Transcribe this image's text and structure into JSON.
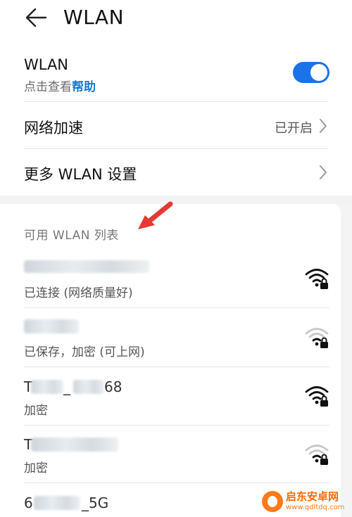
{
  "header": {
    "title": "WLAN"
  },
  "wlan_toggle": {
    "label": "WLAN",
    "sub_prefix": "点击查看",
    "sub_link": "帮助",
    "enabled": true,
    "accent": "#1a73e8"
  },
  "speedup": {
    "label": "网络加速",
    "value": "已开启"
  },
  "more": {
    "label": "更多 WLAN 设置"
  },
  "section": {
    "title": "可用 WLAN 列表"
  },
  "networks": [
    {
      "ssid": "",
      "status": "已连接 (网络质量好)",
      "signal_icon": "wifi-locked-strong-icon"
    },
    {
      "ssid": "",
      "status": "已保存，加密 (可上网)",
      "signal_icon": "wifi-locked-weak-icon"
    },
    {
      "ssid": "T_68",
      "ssid_visible": "68",
      "ssid_prefix": "T",
      "ssid_mid": "_",
      "status": "加密",
      "signal_icon": "wifi-locked-strong-icon"
    },
    {
      "ssid": "T",
      "ssid_prefix": "T",
      "status": "加密",
      "signal_icon": "wifi-locked-weak-icon"
    },
    {
      "ssid_prefix": "6",
      "ssid_suffix": "_5G",
      "status": "",
      "signal_icon": "wifi-locked-strong-icon"
    }
  ],
  "watermark": {
    "name": "启东安卓网",
    "url": "www.qdltdq.com"
  }
}
